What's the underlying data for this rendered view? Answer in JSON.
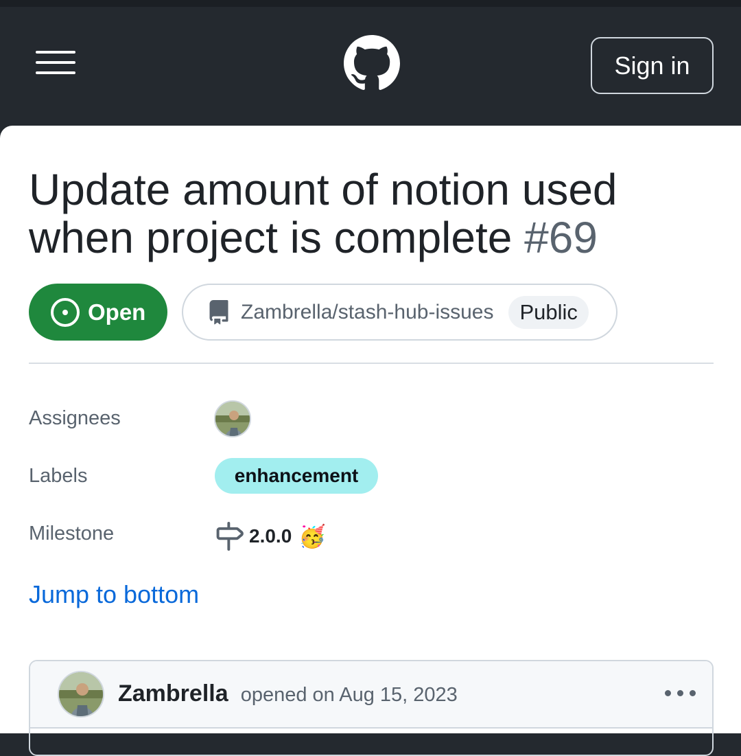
{
  "header": {
    "menu_icon": "hamburger-menu-icon",
    "logo_icon": "github-mark-icon",
    "sign_in_label": "Sign in"
  },
  "issue": {
    "title": "Update amount of notion used when project is complete",
    "number": "#69",
    "state": {
      "label": "Open",
      "icon": "issue-opened-icon",
      "color": "#1f883d"
    },
    "repo": {
      "icon": "repo-icon",
      "name": "Zambrella/stash-hub-issues",
      "visibility": "Public"
    }
  },
  "meta": {
    "assignees_label": "Assignees",
    "labels_label": "Labels",
    "label_chip": "enhancement",
    "label_color": "#a2eeef",
    "milestone_label": "Milestone",
    "milestone_icon": "milestone-icon",
    "milestone_value": "2.0.0",
    "milestone_emoji": "🥳"
  },
  "jump_to_bottom": "Jump to bottom",
  "comment": {
    "author": "Zambrella",
    "action": "opened on Aug 15, 2023",
    "menu_icon": "kebab-horizontal-icon"
  },
  "colors": {
    "header_bg": "#24292f",
    "link": "#0969da"
  }
}
